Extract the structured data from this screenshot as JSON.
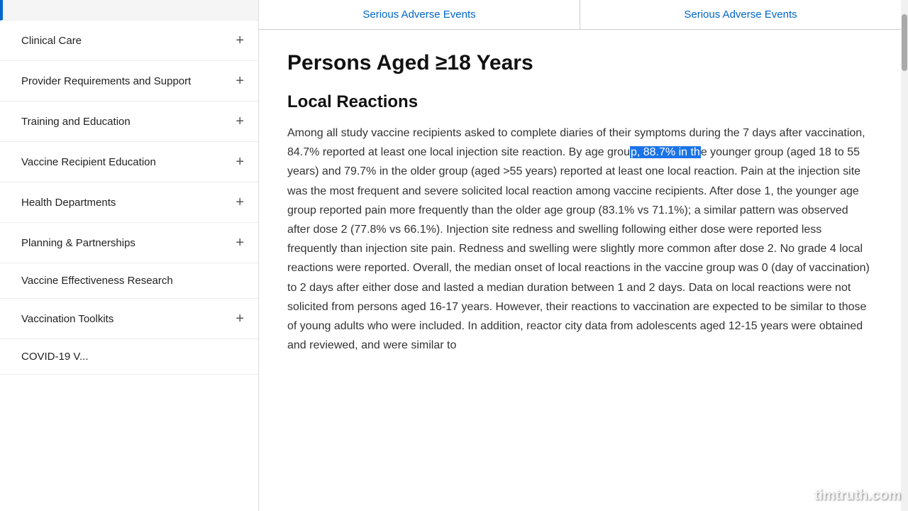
{
  "sidebar": {
    "items": [
      {
        "id": "clinical-care",
        "label": "Clinical Care",
        "hasPlus": true,
        "active": false
      },
      {
        "id": "provider-requirements",
        "label": "Provider Requirements and Support",
        "hasPlus": true,
        "active": false
      },
      {
        "id": "training-education",
        "label": "Training and Education",
        "hasPlus": true,
        "active": false
      },
      {
        "id": "vaccine-recipient",
        "label": "Vaccine Recipient Education",
        "hasPlus": true,
        "active": false
      },
      {
        "id": "health-departments",
        "label": "Health Departments",
        "hasPlus": true,
        "active": false
      },
      {
        "id": "planning-partnerships",
        "label": "Planning & Partnerships",
        "hasPlus": true,
        "active": false
      },
      {
        "id": "vaccine-effectiveness",
        "label": "Vaccine Effectiveness Research",
        "hasPlus": false,
        "active": false
      },
      {
        "id": "vaccination-toolkits",
        "label": "Vaccination Toolkits",
        "hasPlus": true,
        "active": false
      },
      {
        "id": "covid-19-more",
        "label": "COVID-19 V...",
        "hasPlus": false,
        "active": false
      }
    ]
  },
  "tabs": [
    {
      "id": "tab-serious-1",
      "label": "Serious Adverse Events"
    },
    {
      "id": "tab-serious-2",
      "label": "Serious Adverse Events"
    }
  ],
  "main": {
    "page_title": "Persons Aged ≥18 Years",
    "section_title": "Local Reactions",
    "body_before_highlight": "Among all study vaccine recipients asked to complete diaries of their symptoms during the 7 days after vaccination, 84.7% reported at least one local injection site reaction. By age grou",
    "highlight_text": "p, 88.7% in th",
    "body_after_highlight": "e younger group (aged 18 to 55 years) and 79.7% in the older group (aged >55 years) reported at least one local reaction. Pain at the injection site was the most frequent and severe solicited local reaction among vaccine recipients. After dose 1, the younger age group reported pain more frequently than the older age group (83.1% vs 71.1%); a similar pattern was observed after dose 2 (77.8% vs 66.1%). Injection site redness and swelling following either dose were reported less frequently than injection site pain. Redness and swelling were slightly more common after dose 2. No grade 4 local reactions were reported. Overall, the median onset of local reactions in the vaccine group was 0 (day of vaccination) to 2 days after either dose and lasted a median duration between 1 and 2 days. Data on local reactions were not solicited from persons aged 16-17 years. However, their reactions to vaccination are expected to be similar to those of young adults who were included. In addition, reactor city data from adolescents aged 12-15 years were obtained and reviewed, and were similar to"
  },
  "watermark": "timtruth.com"
}
